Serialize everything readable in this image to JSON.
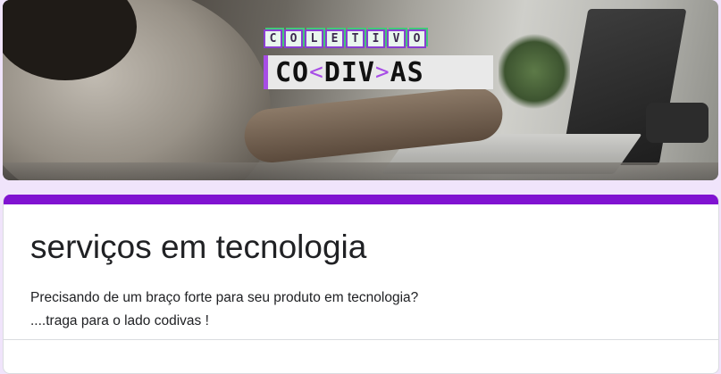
{
  "banner": {
    "logo_top_letters": [
      "C",
      "O",
      "L",
      "E",
      "T",
      "I",
      "V",
      "O"
    ],
    "logo_main_left": "CO",
    "logo_bracket_open": "<",
    "logo_main_mid": "DIV",
    "logo_bracket_close": ">",
    "logo_main_right": "AS"
  },
  "form": {
    "accent_color": "#8012d1",
    "title": "serviços em tecnologia",
    "description_line1": "Precisando de um braço forte para seu produto  em tecnologia?",
    "description_line2": "....traga para o lado codivas !"
  }
}
